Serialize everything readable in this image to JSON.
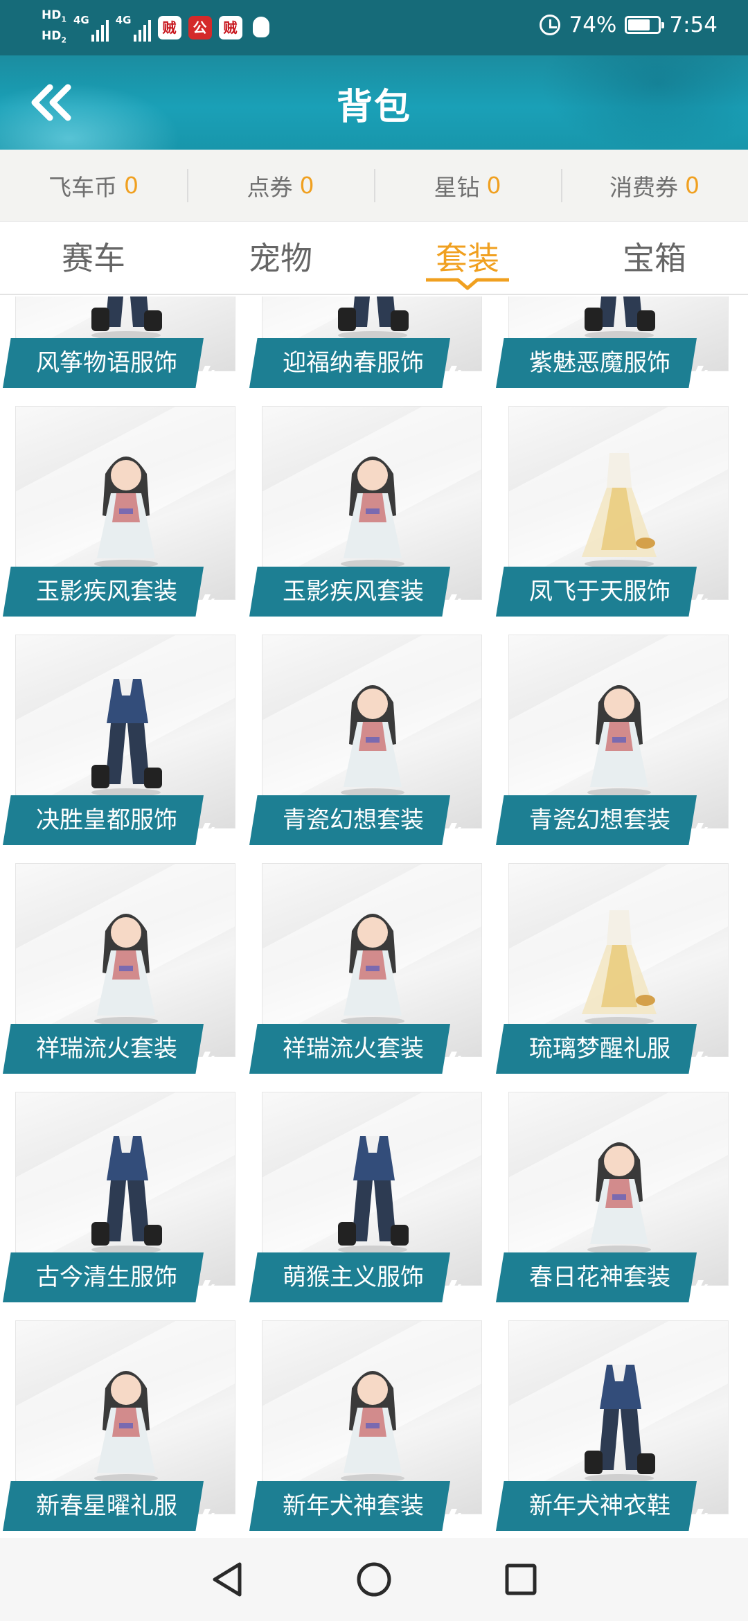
{
  "status_bar": {
    "hd1": "HD",
    "hd1_sub": "1",
    "hd2": "HD",
    "hd2_sub": "2",
    "network1": "4G",
    "network2": "4G",
    "apps": [
      "贼",
      "公",
      "贼"
    ],
    "battery_percent": "74%",
    "battery_level": 0.74,
    "time": "7:54"
  },
  "header": {
    "title": "背包",
    "back_icon": "double-chevron-left-icon"
  },
  "currencies": [
    {
      "name": "飞车币",
      "value": "0"
    },
    {
      "name": "点券",
      "value": "0"
    },
    {
      "name": "星钻",
      "value": "0"
    },
    {
      "name": "消费券",
      "value": "0"
    }
  ],
  "tabs": [
    {
      "label": "赛车",
      "active": false
    },
    {
      "label": "宠物",
      "active": false
    },
    {
      "label": "套装",
      "active": true
    },
    {
      "label": "宝箱",
      "active": false
    }
  ],
  "items": [
    {
      "name": "风筝物语服饰",
      "figure": "outfit-icon"
    },
    {
      "name": "迎福纳春服饰",
      "figure": "outfit-icon"
    },
    {
      "name": "紫魅恶魔服饰",
      "figure": "outfit-icon"
    },
    {
      "name": "玉影疾风套装",
      "figure": "character-icon"
    },
    {
      "name": "玉影疾风套装",
      "figure": "character-icon"
    },
    {
      "name": "凤飞于天服饰",
      "figure": "dress-icon"
    },
    {
      "name": "决胜皇都服饰",
      "figure": "outfit-icon"
    },
    {
      "name": "青瓷幻想套装",
      "figure": "character-icon"
    },
    {
      "name": "青瓷幻想套装",
      "figure": "character-icon"
    },
    {
      "name": "祥瑞流火套装",
      "figure": "character-icon"
    },
    {
      "name": "祥瑞流火套装",
      "figure": "character-icon"
    },
    {
      "name": "琉璃梦醒礼服",
      "figure": "dress-icon"
    },
    {
      "name": "古今清生服饰",
      "figure": "outfit-icon"
    },
    {
      "name": "萌猴主义服饰",
      "figure": "outfit-icon"
    },
    {
      "name": "春日花神套装",
      "figure": "character-icon"
    },
    {
      "name": "新春星曜礼服",
      "figure": "character-icon"
    },
    {
      "name": "新年犬神套装",
      "figure": "character-icon"
    },
    {
      "name": "新年犬神衣鞋",
      "figure": "outfit-icon"
    }
  ],
  "colors": {
    "status_bar": "#166b79",
    "header": "#1aa0b7",
    "accent": "#f0a020",
    "label": "#1d7f93"
  }
}
